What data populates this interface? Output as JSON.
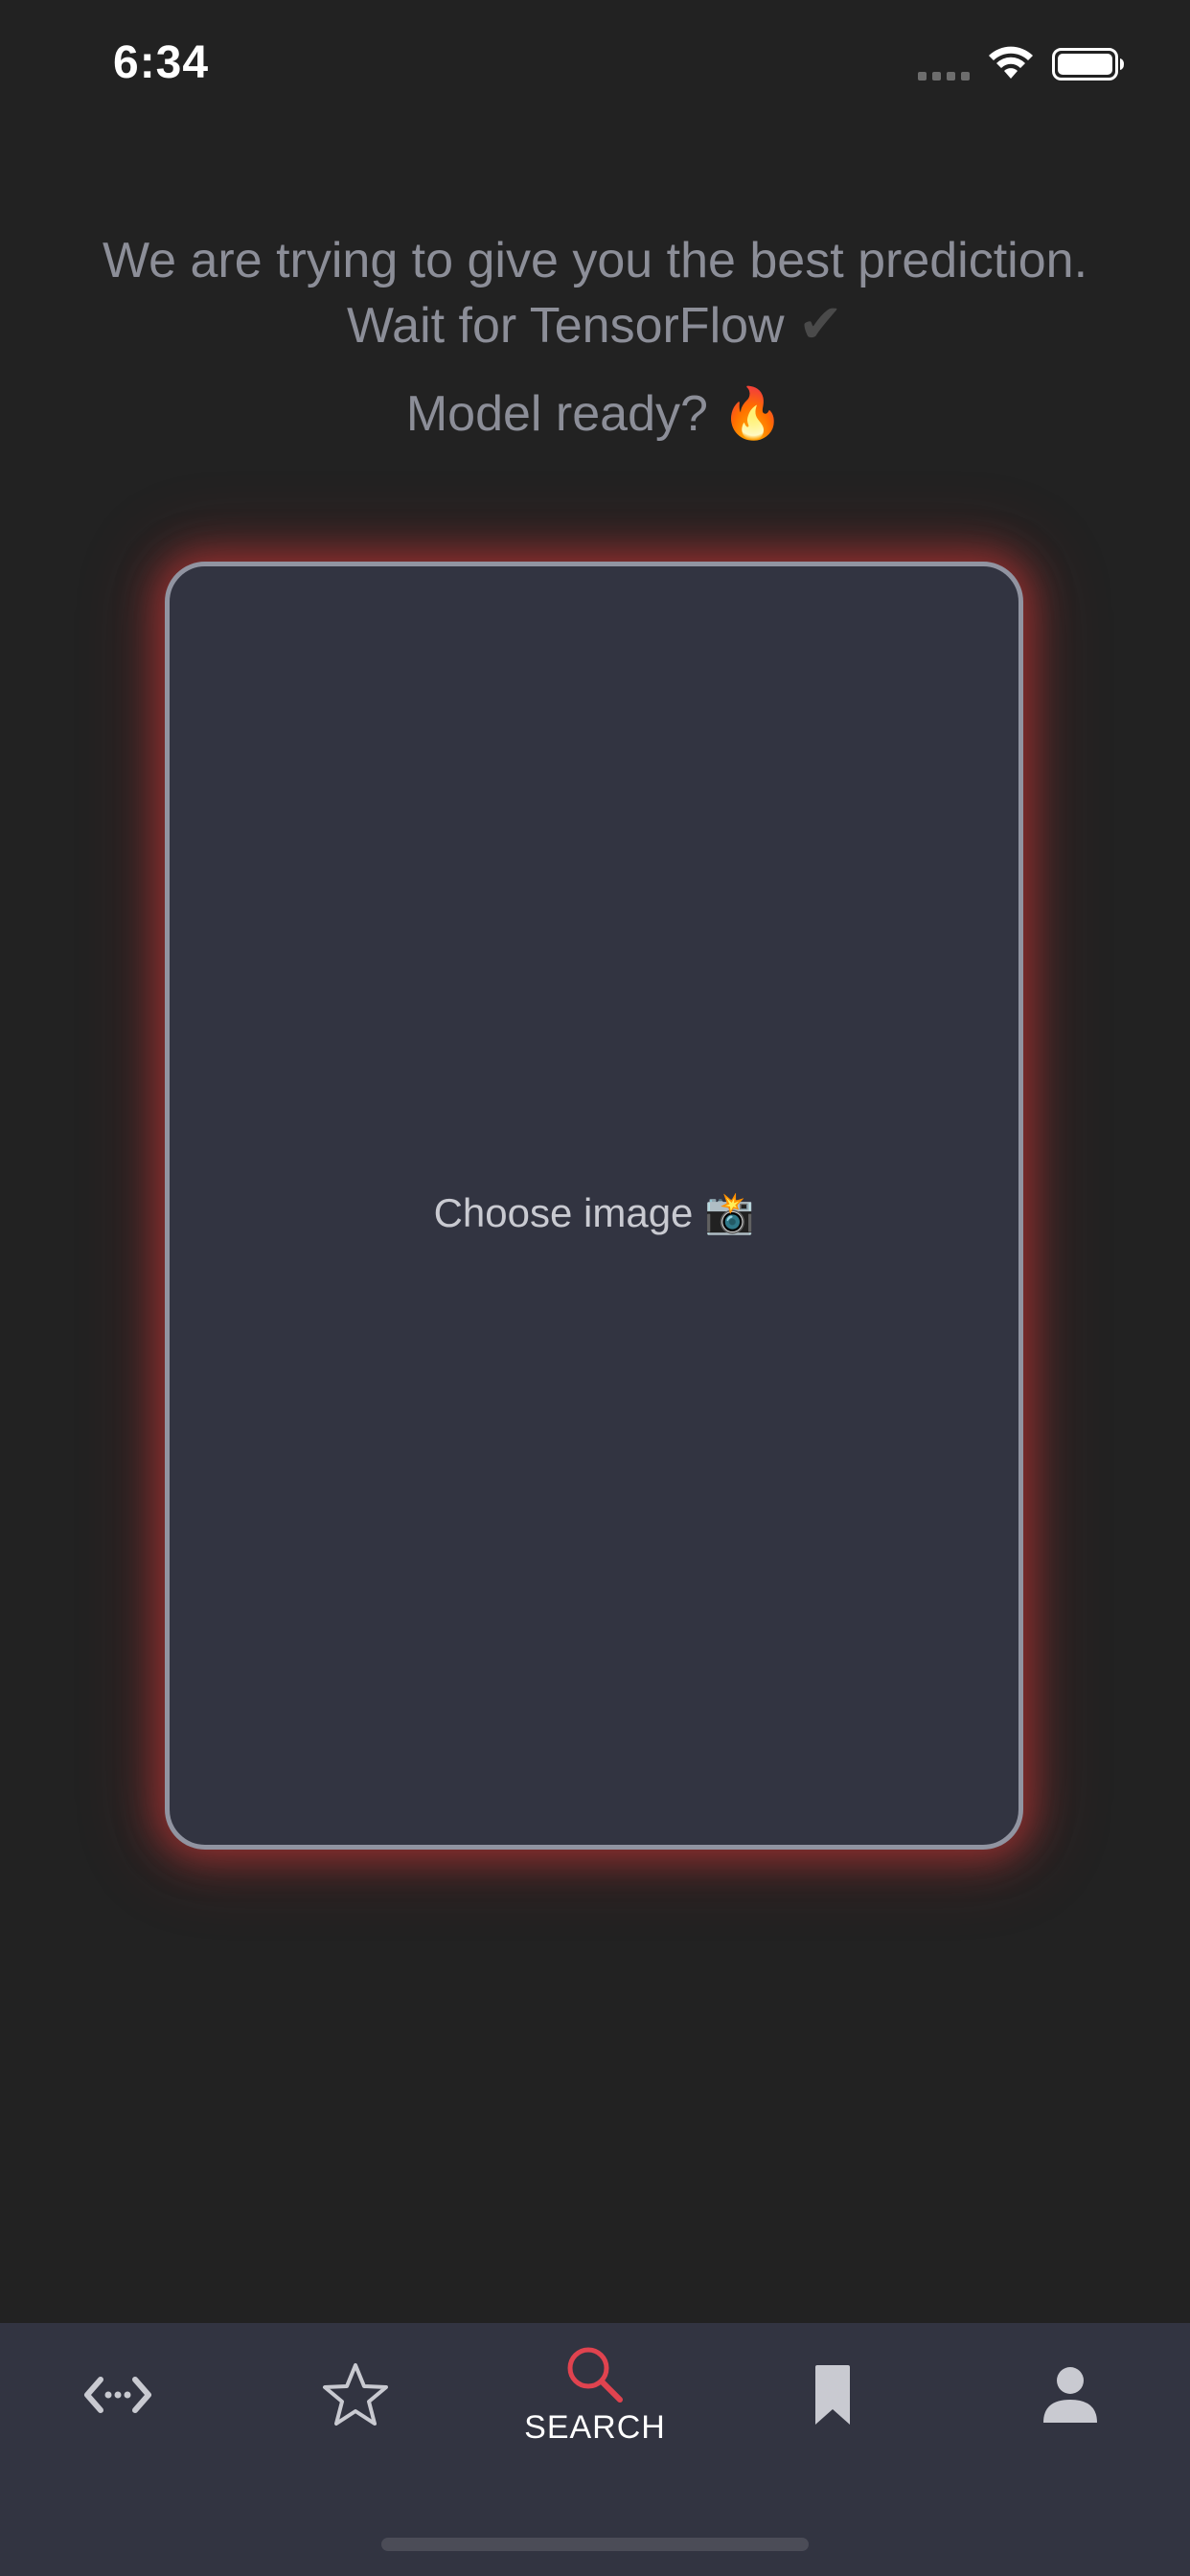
{
  "status_bar": {
    "time": "6:34"
  },
  "header": {
    "line1": "We are trying to give you the best prediction.",
    "line2": "Wait for TensorFlow",
    "line2_check": "✔",
    "line3": "Model ready? 🔥"
  },
  "image_card": {
    "label": "Choose image 📸"
  },
  "tab_bar": {
    "tabs": [
      {
        "icon": "code-icon",
        "label": ""
      },
      {
        "icon": "star-icon",
        "label": ""
      },
      {
        "icon": "search-icon",
        "label": "SEARCH",
        "active": true
      },
      {
        "icon": "bookmark-icon",
        "label": ""
      },
      {
        "icon": "profile-icon",
        "label": ""
      }
    ]
  },
  "colors": {
    "background": "#222222",
    "card_fill": "#323441",
    "card_border": "#9194a1",
    "glow": "#d63a3a",
    "accent": "#e0434f",
    "muted_text": "#8c8e98",
    "tab_icon": "#c9cad1"
  }
}
